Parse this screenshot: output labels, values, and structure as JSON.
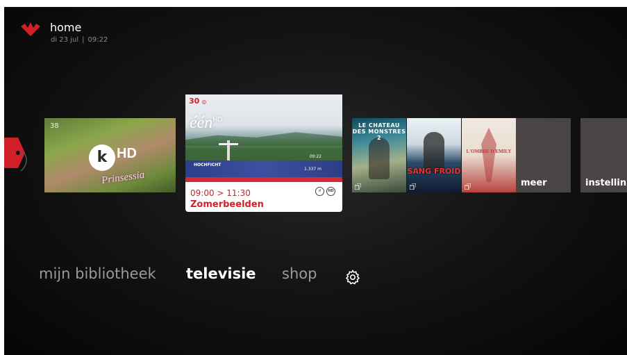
{
  "header": {
    "title": "home",
    "date": "di 23 jul",
    "time": "09:22",
    "logo_icon": "red-bird-logo",
    "accent_color": "#d1202a"
  },
  "carousel": {
    "ketnet": {
      "channel_number": "38",
      "badge_letter": "k",
      "hd_label": "HD",
      "program_art_text": "Prinsessia"
    },
    "een": {
      "channel_number": "30",
      "logo": "één",
      "logo_hd": "HD",
      "overlay_place": "HOCHFICHT",
      "overlay_alt": "1.337 m",
      "overlay_time": "09:22",
      "time_range": "09:00 > 11:30",
      "title": "Zomerbeelden",
      "icons": [
        "replay-icon",
        "hd-icon"
      ]
    },
    "posters": [
      {
        "title": "LE CHATEAU DES MONSTRES 2"
      },
      {
        "title": "SANG FROID"
      },
      {
        "title": "L'OMBRE D'EMILY"
      }
    ],
    "meer_label": "meer",
    "instellingen_label": "instellin"
  },
  "nav": {
    "bibliotheek": "mijn bibliotheek",
    "televisie": "televisie",
    "shop": "shop",
    "settings_icon": "gear-icon"
  }
}
